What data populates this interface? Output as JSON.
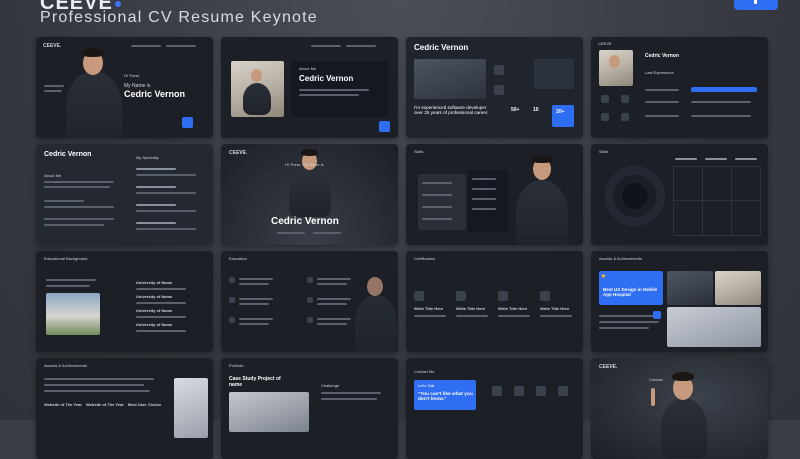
{
  "header": {
    "brand": "CEEVE",
    "title": "Professional CV Resume Keynote"
  },
  "slides": {
    "s1": {
      "logo": "CEEVE.",
      "greet": "Hi There,",
      "name_line": "My Name is",
      "name": "Cedric Vernon"
    },
    "s2": {
      "about": "About Me",
      "name": "Cedric Vernon"
    },
    "s3": {
      "name": "Cedric Vernon",
      "quote": "I'm experienced software developer over 25 years of professional career.",
      "stat1": "50+",
      "stat2": "10",
      "stat3": "20+"
    },
    "s4": {
      "logo": "CEEVE",
      "name": "Cedric Vernon",
      "label": "Last Experience"
    },
    "s5": {
      "name": "Cedric Vernon",
      "about": "About Me",
      "specialty": "My Specialty"
    },
    "s6": {
      "logo": "CEEVE.",
      "greet": "Hi There, My Name is",
      "name": "Cedric Vernon"
    },
    "s7": {
      "skills": "Skills"
    },
    "s8": {
      "skills": "Skills"
    },
    "s9": {
      "title": "Educational Background",
      "school": "University of Name"
    },
    "s10": {
      "title": "Education"
    },
    "s11": {
      "title": "Certification",
      "cert": "Write Title Here"
    },
    "s12": {
      "title": "Awards & Achievements",
      "award": "Best UX Design in Mobile App Hospital"
    },
    "s13": {
      "title": "Awards & Achievements",
      "a1": "Website of The Year",
      "a2": "Website of The Year",
      "a3": "Best User Choice"
    },
    "s14": {
      "title": "Portfolio",
      "case": "Case Study Project of name",
      "challenge": "Challenge"
    },
    "s15": {
      "title": "Contact Me",
      "lets": "Let's Talk",
      "quote": "\"You can't like what you don't know.\""
    },
    "s16": {
      "logo": "CEEVE.",
      "contact": "Contact"
    }
  },
  "colors": {
    "accent": "#2f6df2",
    "slide_bg": "#1c1f26",
    "page_bg": "#3a3d45"
  }
}
